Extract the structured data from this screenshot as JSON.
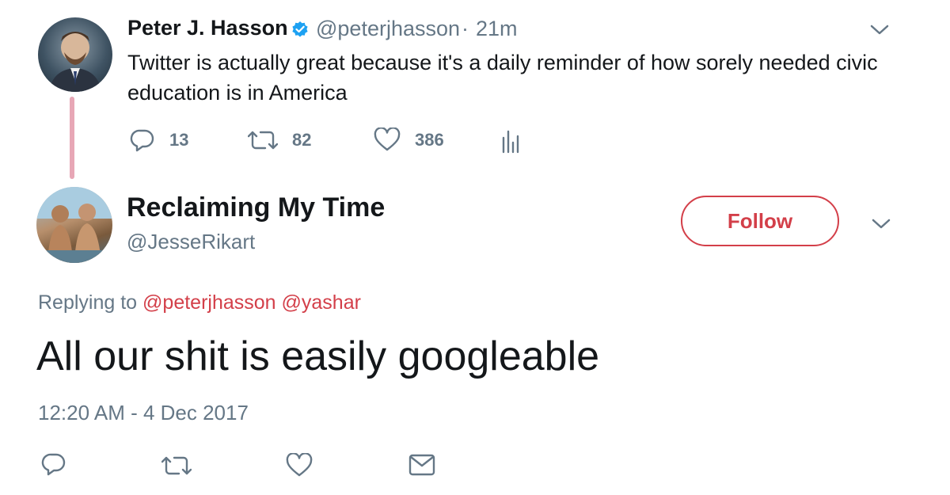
{
  "parent_tweet": {
    "display_name": "Peter J. Hasson",
    "handle": "@peterjhasson",
    "separator": "·",
    "time": "21m",
    "text": "Twitter is actually great because it's a daily reminder of how sorely needed civic education is in America",
    "reply_count": "13",
    "retweet_count": "82",
    "like_count": "386"
  },
  "reply_tweet": {
    "display_name": "Reclaiming My Time",
    "handle": "@JesseRikart",
    "follow_label": "Follow",
    "replying_prefix": "Replying to",
    "mentions": [
      "@peterjhasson",
      "@yashar"
    ],
    "text": "All our shit is easily googleable",
    "timestamp": "12:20 AM - 4 Dec 2017"
  },
  "colors": {
    "accent": "#d33f49",
    "muted_text": "#657786",
    "primary_text": "#14171a",
    "thread_line": "#e7a7b6",
    "verified": "#1da1f2"
  },
  "icons": {
    "verified": "verified-badge-icon",
    "chevron": "chevron-down-icon",
    "reply": "reply-icon",
    "retweet": "retweet-icon",
    "like": "heart-icon",
    "analytics": "analytics-icon",
    "message": "envelope-icon"
  }
}
